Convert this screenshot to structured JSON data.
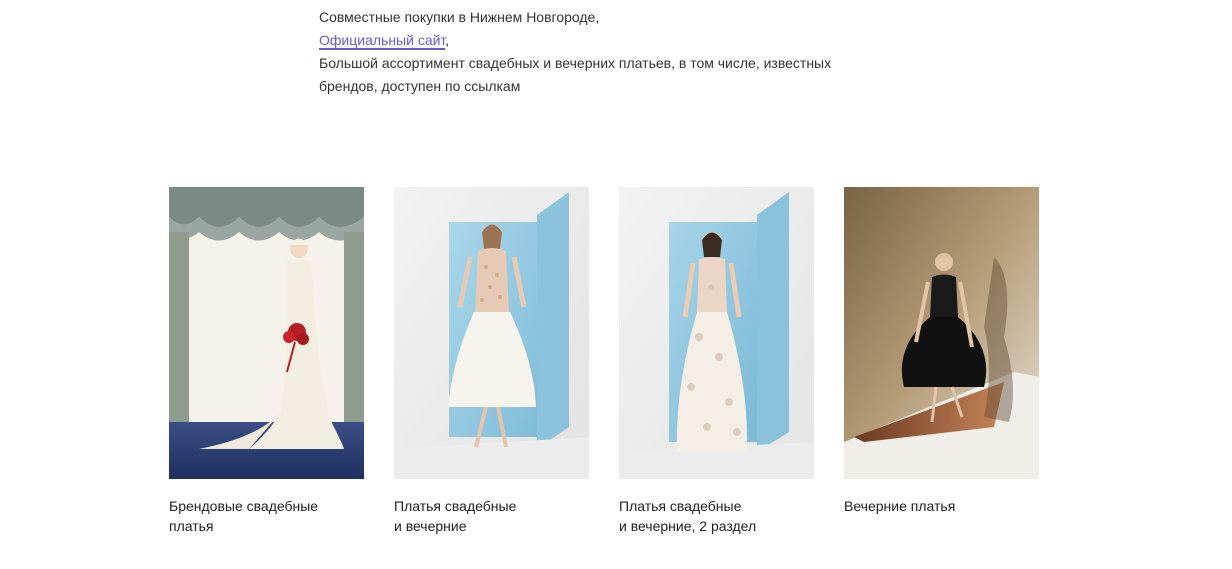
{
  "intro": {
    "line1": "Совместные покупки в Нижнем Новгороде,",
    "link_text": "Официальный сайт",
    "link_suffix": ",",
    "line3": "Большой ассортимент свадебных и вечерних платьев, в том числе, известных брендов, доступен по ссылкам"
  },
  "cards": [
    {
      "caption": "Брендовые свадебные платья"
    },
    {
      "caption": "Платья свадебные\nи вечерние"
    },
    {
      "caption": "Платья свадебные\nи вечерние, 2 раздел"
    },
    {
      "caption": "Вечерние платья"
    }
  ],
  "colors": {
    "link": "#6a5acd",
    "text": "#333333"
  }
}
